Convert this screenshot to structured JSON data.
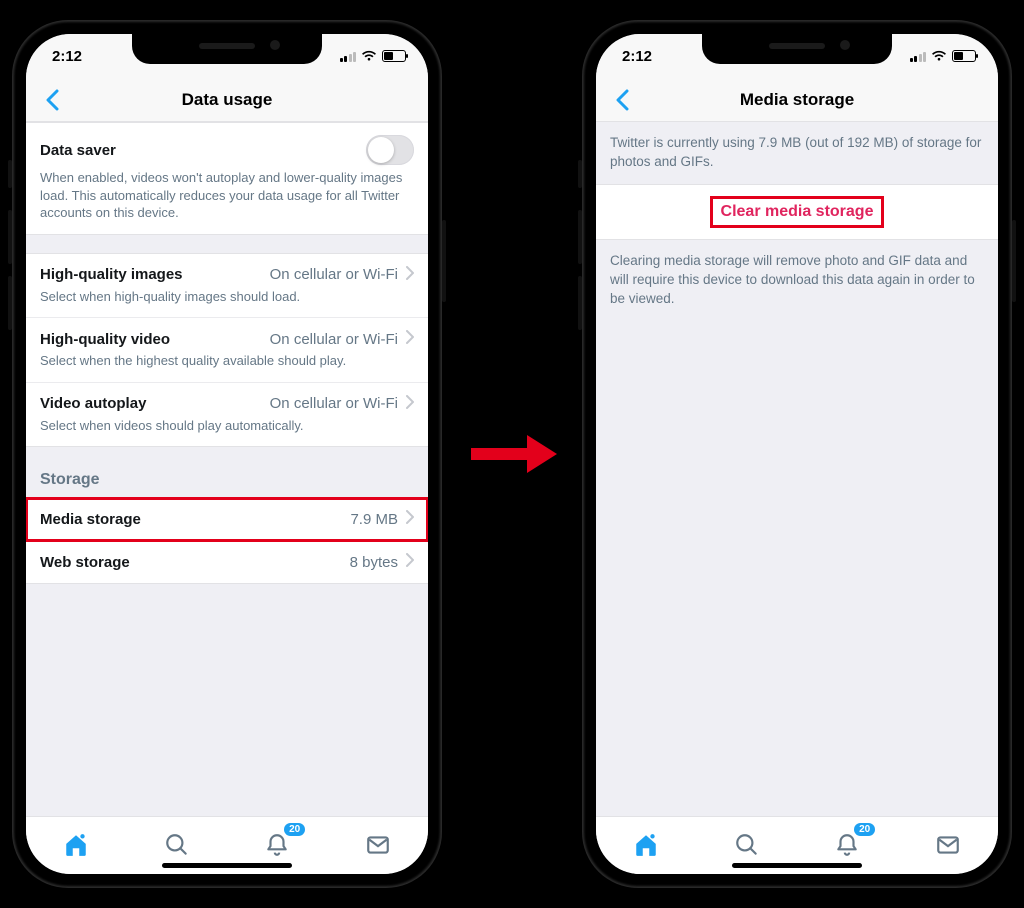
{
  "status": {
    "time": "2:12"
  },
  "left": {
    "title": "Data usage",
    "datasaver": {
      "label": "Data saver",
      "desc": "When enabled, videos won't autoplay and lower-quality images load. This automatically reduces your data usage for all Twitter accounts on this device."
    },
    "hqImages": {
      "label": "High-quality images",
      "value": "On cellular or Wi-Fi",
      "desc": "Select when high-quality images should load."
    },
    "hqVideo": {
      "label": "High-quality video",
      "value": "On cellular or Wi-Fi",
      "desc": "Select when the highest quality available should play."
    },
    "autoplay": {
      "label": "Video autoplay",
      "value": "On cellular or Wi-Fi",
      "desc": "Select when videos should play automatically."
    },
    "storageHeader": "Storage",
    "mediaStorage": {
      "label": "Media storage",
      "value": "7.9 MB"
    },
    "webStorage": {
      "label": "Web storage",
      "value": "8 bytes"
    }
  },
  "right": {
    "title": "Media storage",
    "info": "Twitter is currently using 7.9 MB (out of 192 MB) of storage for photos and GIFs.",
    "action": "Clear media storage",
    "warn": "Clearing media storage will remove photo and GIF data and will require this device to download this data again in order to be viewed."
  },
  "tabs": {
    "badge": "20"
  }
}
